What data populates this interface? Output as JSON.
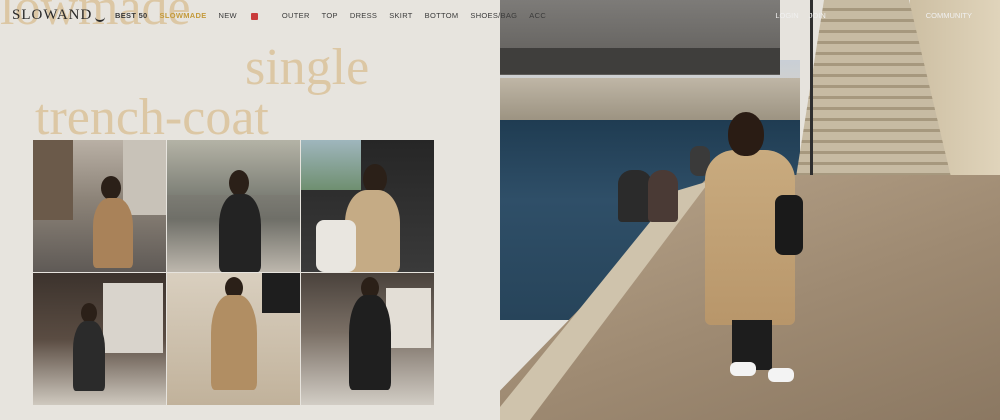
{
  "header": {
    "logo": "SLOWAND",
    "nav": [
      "BEST 50",
      "SLOWMADE",
      "NEW",
      "OUTER",
      "TOP",
      "DRESS",
      "SKIRT",
      "BOTTOM",
      "SHOES/BAG",
      "ACC"
    ],
    "right_links": [
      "LOGIN",
      "JOIN",
      "COMMUNITY"
    ]
  },
  "hero": {
    "line1": "lowmade",
    "line2": "single",
    "line3": "trench-coat"
  },
  "colors": {
    "accent": "#c49a3b",
    "headline": "#dcc7a4"
  },
  "gallery": {
    "photos": [
      "street-photo",
      "window-photo",
      "car-photo",
      "shop-photo",
      "wall-photo",
      "store-photo"
    ]
  }
}
